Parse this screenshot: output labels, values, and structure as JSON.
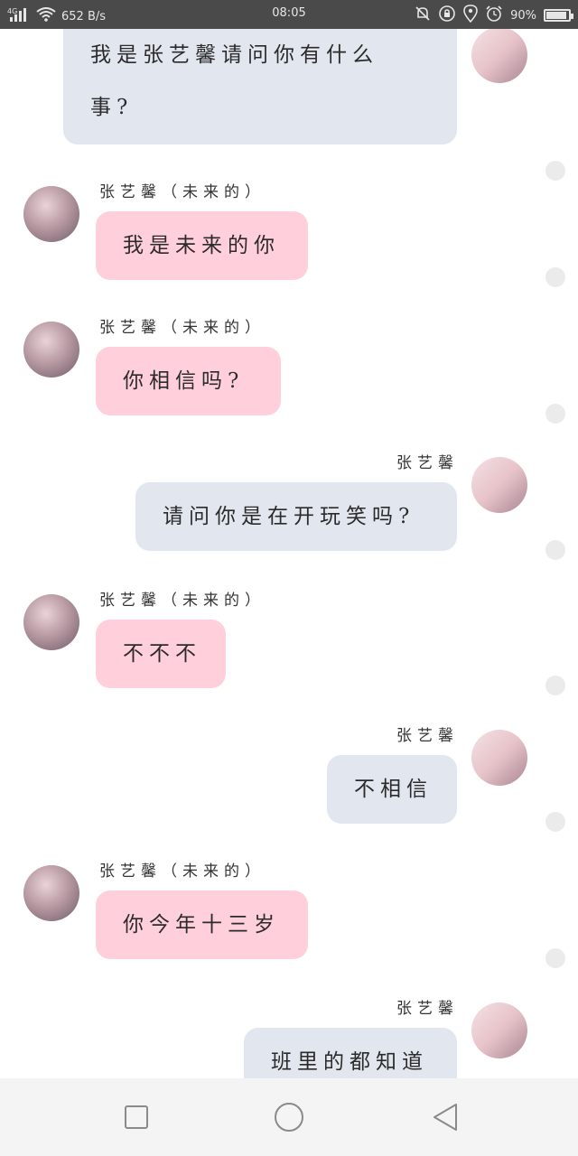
{
  "status_bar": {
    "network": "4G",
    "speed": "652 B/s",
    "time": "08:05",
    "battery": "90%",
    "battery_level": 0.9
  },
  "messages": [
    {
      "side": "me",
      "sender": "",
      "text_lines": [
        "我是张艺馨请问你有什么",
        "事?"
      ]
    },
    {
      "side": "other",
      "sender": "张艺馨（未来的）",
      "text": "我是未来的你"
    },
    {
      "side": "other",
      "sender": "张艺馨（未来的）",
      "text": "你相信吗?"
    },
    {
      "side": "me",
      "sender": "张艺馨",
      "text": "请问你是在开玩笑吗?"
    },
    {
      "side": "other",
      "sender": "张艺馨（未来的）",
      "text": "不不不"
    },
    {
      "side": "me",
      "sender": "张艺馨",
      "text": "不相信"
    },
    {
      "side": "other",
      "sender": "张艺馨（未来的）",
      "text": "你今年十三岁"
    },
    {
      "side": "me",
      "sender": "张艺馨",
      "text": "班里的都知道"
    }
  ],
  "colors": {
    "other_bubble": "#ffd0db",
    "me_bubble": "#e1e6ef",
    "status_bar": "#4a4a4a",
    "nav_bar": "#f4f4f4"
  },
  "icons": {
    "nav": [
      "square-icon",
      "circle-icon",
      "triangle-back-icon"
    ]
  }
}
